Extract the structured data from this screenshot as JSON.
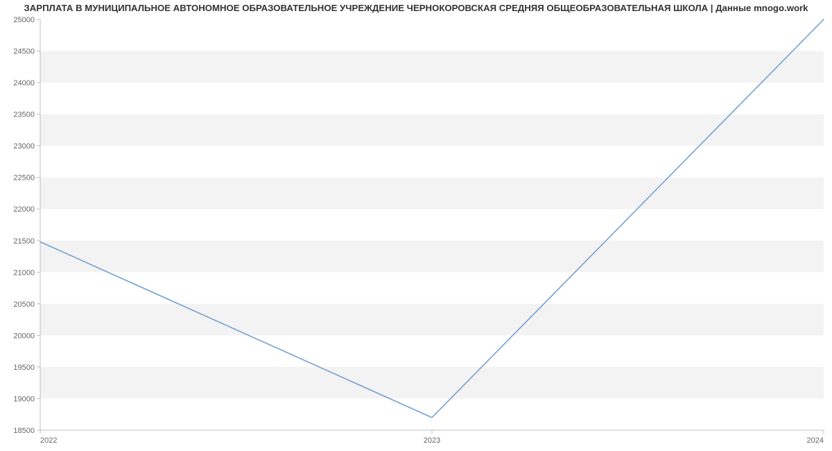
{
  "chart_data": {
    "type": "line",
    "title": "ЗАРПЛАТА В МУНИЦИПАЛЬНОЕ АВТОНОМНОЕ ОБРАЗОВАТЕЛЬНОЕ УЧРЕЖДЕНИЕ ЧЕРНОКОРОВСКАЯ СРЕДНЯЯ ОБЩЕОБРАЗОВАТЕЛЬНАЯ ШКОЛА | Данные mnogo.work",
    "categories": [
      "2022",
      "2023",
      "2024"
    ],
    "values": [
      21480,
      18700,
      25000
    ],
    "y_ticks": [
      18500,
      19000,
      19500,
      20000,
      20500,
      21000,
      21500,
      22000,
      22500,
      23000,
      23500,
      24000,
      24500,
      25000
    ],
    "ylim": [
      18500,
      25000
    ],
    "xlabel": "",
    "ylabel": "",
    "line_color": "#6b9bd2",
    "band_color": "#f3f3f3"
  }
}
